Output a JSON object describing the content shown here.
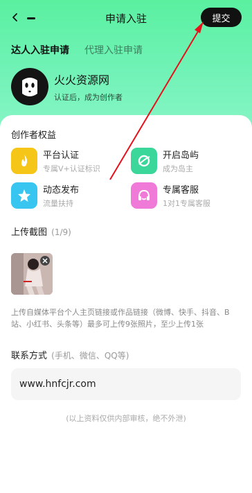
{
  "nav": {
    "title": "申请入驻",
    "submit_label": "提交"
  },
  "tabs": [
    {
      "label": "达人入驻申请",
      "active": true
    },
    {
      "label": "代理入驻申请",
      "active": false
    }
  ],
  "profile": {
    "name": "火火资源网",
    "subtitle": "认证后，成为创作者"
  },
  "benefits": {
    "title": "创作者权益",
    "items": [
      {
        "title": "平台认证",
        "sub": "专属V+认证标识",
        "icon": "flame-icon",
        "color": "#f5c518"
      },
      {
        "title": "开启岛屿",
        "sub": "成为岛主",
        "icon": "island-icon",
        "color": "#3ad69a"
      },
      {
        "title": "动态发布",
        "sub": "流量扶持",
        "icon": "star-icon",
        "color": "#38c6f0"
      },
      {
        "title": "专属客服",
        "sub": "1对1专属客服",
        "icon": "headset-icon",
        "color": "#f07ad8"
      }
    ]
  },
  "upload": {
    "title": "上传截图",
    "count": "(1/9)",
    "thumbnail_icon": "photo-thumbnail",
    "description": "上传自媒体平台个人主页链接或作品链接（微博、快手、抖音、B站、小红书、头条等）最多可上传9张照片，至少上传1张"
  },
  "contact": {
    "title": "联系方式",
    "hint": "(手机、微信、QQ等)",
    "value": "www.hnfcjr.com"
  },
  "privacy_note": "(以上资料仅供内部审核，绝不外泄)",
  "colors": {
    "accent": "#5af0a0",
    "annotation_arrow": "#e8101a",
    "dark": "#111111"
  }
}
